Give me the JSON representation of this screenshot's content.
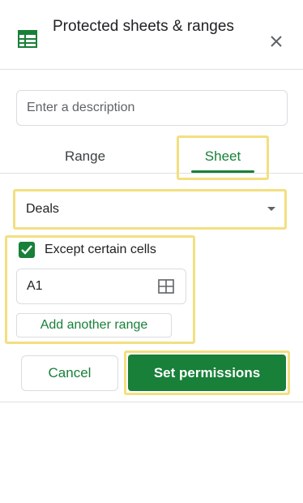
{
  "header": {
    "title": "Protected sheets & ranges",
    "icon": "google-sheets-icon",
    "close_icon": "close-icon"
  },
  "description": {
    "placeholder": "Enter a description",
    "value": ""
  },
  "tabs": [
    {
      "label": "Range",
      "active": false
    },
    {
      "label": "Sheet",
      "active": true
    }
  ],
  "sheet_select": {
    "value": "Deals",
    "icon": "dropdown-arrow-icon"
  },
  "except_cells": {
    "checked": true,
    "label": "Except certain cells",
    "range_value": "A1",
    "range_icon": "grid-select-icon",
    "add_range_label": "Add another range"
  },
  "actions": {
    "cancel_label": "Cancel",
    "set_permissions_label": "Set permissions"
  },
  "colors": {
    "accent": "#188038",
    "highlight": "#f3df80",
    "border": "#dadce0"
  }
}
